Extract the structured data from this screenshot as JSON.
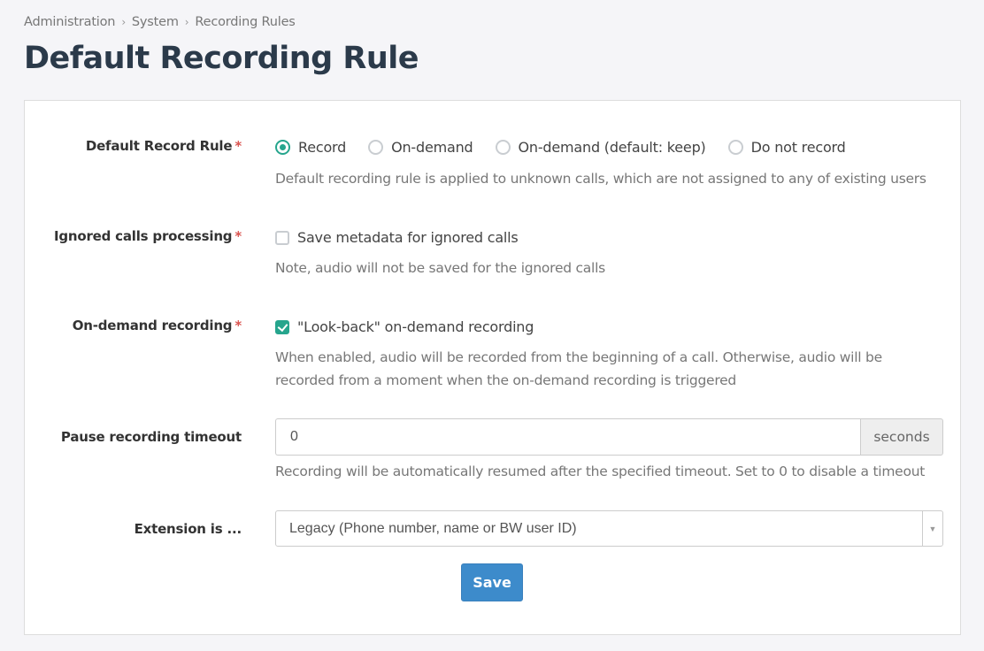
{
  "breadcrumb": [
    "Administration",
    "System",
    "Recording Rules"
  ],
  "breadcrumb_separator": "›",
  "page_title": "Default Recording Rule",
  "colors": {
    "accent": "#26a58d",
    "primary_button": "#3d8bcb",
    "required": "#d9534f"
  },
  "form": {
    "default_record_rule": {
      "label": "Default Record Rule",
      "required": "*",
      "options": [
        "Record",
        "On-demand",
        "On-demand (default: keep)",
        "Do not record"
      ],
      "selected": "Record",
      "help": "Default recording rule is applied to unknown calls, which are not assigned to any of existing users"
    },
    "ignored_calls": {
      "label": "Ignored calls processing",
      "required": "*",
      "checkbox_label": "Save metadata for ignored calls",
      "checked": false,
      "help": "Note, audio will not be saved for the ignored calls"
    },
    "on_demand": {
      "label": "On-demand recording",
      "required": "*",
      "checkbox_label": "\"Look-back\" on-demand recording",
      "checked": true,
      "help_line1": "When enabled, audio will be recorded from the beginning of a call. Otherwise, audio will be",
      "help_line2": "recorded from a moment when the on-demand recording is triggered"
    },
    "pause_timeout": {
      "label": "Pause recording timeout",
      "value": "0",
      "unit": "seconds",
      "help": "Recording will be automatically resumed after the specified timeout. Set to 0 to disable a timeout"
    },
    "extension": {
      "label": "Extension is ...",
      "selected": "Legacy (Phone number, name or BW user ID)",
      "arrow_icon": "▼"
    },
    "save_label": "Save"
  }
}
